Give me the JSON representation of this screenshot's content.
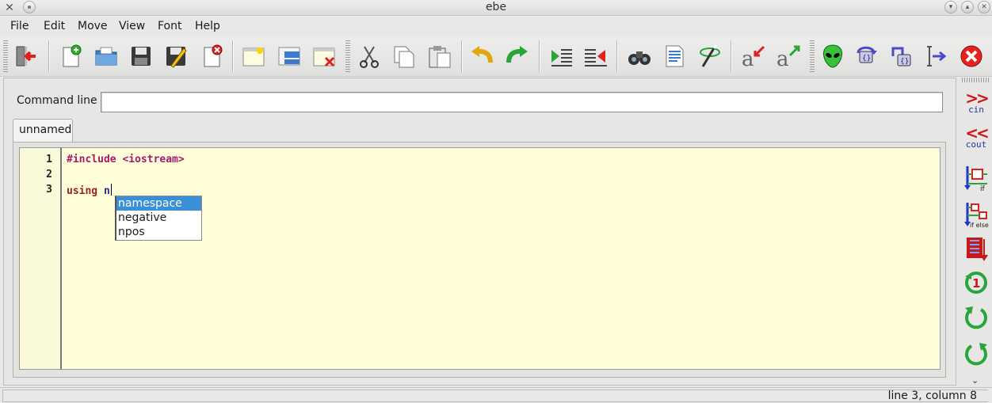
{
  "window": {
    "title": "ebe"
  },
  "menu": {
    "items": [
      "File",
      "Edit",
      "Move",
      "View",
      "Font",
      "Help"
    ]
  },
  "toolbar": {
    "icons": [
      "exit-icon",
      "new-file-icon",
      "open-file-icon",
      "save-icon",
      "save-as-icon",
      "close-file-icon",
      "new-pane-icon",
      "dock-pane-icon",
      "close-pane-icon",
      "cut-icon",
      "copy-icon",
      "paste-icon",
      "undo-icon",
      "redo-icon",
      "indent-icon",
      "unindent-icon",
      "find-icon",
      "comment-icon",
      "magic-wand-icon",
      "font-smaller-icon",
      "font-larger-icon",
      "alien-icon",
      "step-over-icon",
      "step-into-icon",
      "run-to-cursor-icon",
      "stop-icon"
    ]
  },
  "command_line": {
    "label": "Command line",
    "value": ""
  },
  "tabs": [
    {
      "label": "unnamed"
    }
  ],
  "editor": {
    "line_numbers": [
      "1",
      "2",
      "3"
    ],
    "line1": {
      "text": "#include <iostream>"
    },
    "line2": {
      "text": ""
    },
    "line3": {
      "keyword": "using",
      "space": " ",
      "ident": "n"
    },
    "autocomplete": {
      "items": [
        "namespace",
        "negative",
        "npos"
      ],
      "selected_index": 0
    }
  },
  "right_panel": {
    "cin": {
      "arrows": ">>",
      "label": "cin"
    },
    "cout": {
      "arrows": "<<",
      "label": "cout"
    },
    "icons": [
      "if-icon",
      "if-else-icon",
      "switch-icon",
      "for-loop-icon",
      "while-loop-icon",
      "do-while-loop-icon"
    ]
  },
  "status": {
    "text": "line 3, column 8"
  },
  "colors": {
    "editor_bg": "#fffed8",
    "gutter_bg": "#fafada",
    "preprocessor": "#a21a6c",
    "keyword": "#9a2424",
    "identifier": "#242d8c",
    "selection": "#3a8fd9"
  }
}
